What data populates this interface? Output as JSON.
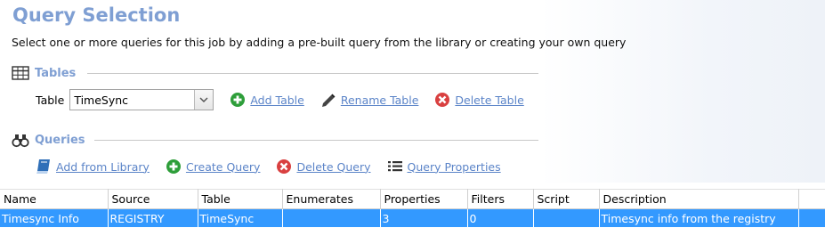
{
  "header": {
    "title": "Query Selection",
    "subtitle": "Select one or more queries for this job by adding a pre-built query from the library or creating your own query"
  },
  "tables_section": {
    "heading": "Tables",
    "table_label": "Table",
    "table_value": "TimeSync",
    "actions": {
      "add": "Add Table",
      "rename": "Rename Table",
      "delete": "Delete Table"
    }
  },
  "queries_section": {
    "heading": "Queries",
    "actions": {
      "add_library": "Add from Library",
      "create": "Create Query",
      "delete": "Delete Query",
      "properties": "Query Properties"
    }
  },
  "grid": {
    "columns": [
      "Name",
      "Source",
      "Table",
      "Enumerates",
      "Properties",
      "Filters",
      "Script",
      "Description"
    ],
    "rows": [
      {
        "name": "Timesync Info",
        "source": "REGISTRY",
        "table": "TimeSync",
        "enumerates": "",
        "properties": "3",
        "filters": "0",
        "script": "",
        "description": "Timesync info from the registry",
        "selected": true
      }
    ]
  },
  "colors": {
    "title": "#7f9fd3",
    "link": "#5b84c8",
    "selection": "#3399ff",
    "add_green": "#2e9e3a",
    "delete_red": "#d94040"
  },
  "icons": {
    "tables": "table-grid-icon",
    "queries": "binoculars-icon",
    "add": "plus-circle-icon",
    "rename": "pencil-icon",
    "delete": "x-circle-icon",
    "library": "book-icon",
    "properties": "list-icon",
    "dropdown": "chevron-down-icon"
  }
}
